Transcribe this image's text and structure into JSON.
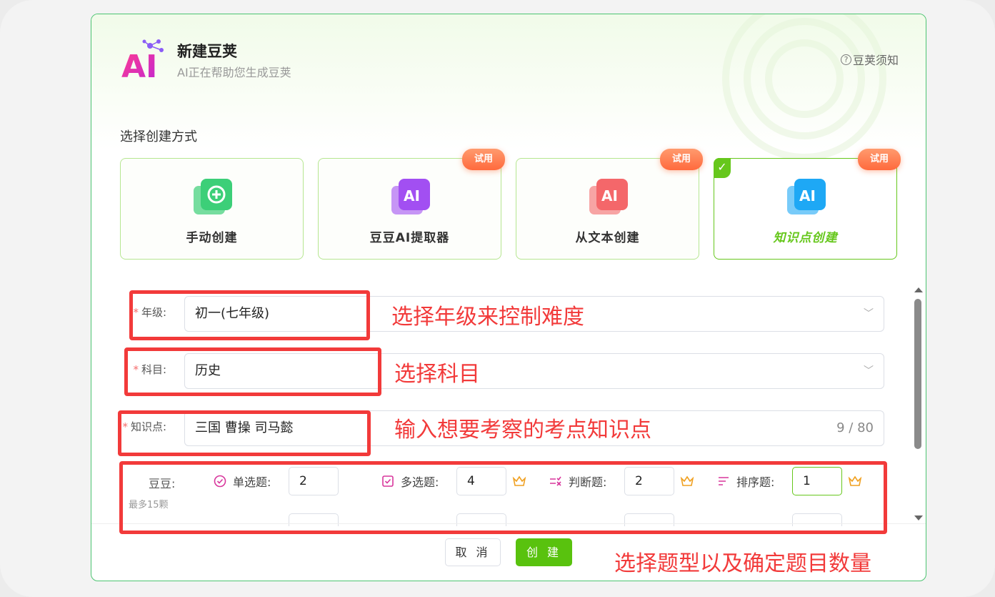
{
  "header": {
    "title": "新建豆荚",
    "subtitle": "AI正在帮助您生成豆荚",
    "notice_label": "豆荚须知",
    "logo_text": "AI"
  },
  "section_label": "选择创建方式",
  "cards": [
    {
      "label": "手动创建",
      "icon": "plus-circle-icon",
      "color": "#3ccf78",
      "trial": "",
      "selected": false
    },
    {
      "label": "豆豆AI提取器",
      "icon": "ai-icon",
      "color": "#a24ff2",
      "trial": "试用",
      "selected": false
    },
    {
      "label": "从文本创建",
      "icon": "ai-icon",
      "color": "#f4676a",
      "trial": "试用",
      "selected": false
    },
    {
      "label": "知识点创建",
      "icon": "ai-icon",
      "color": "#1ea8f5",
      "trial": "试用",
      "selected": true
    }
  ],
  "form": {
    "grade": {
      "label": "年级:",
      "value": "初一(七年级)"
    },
    "subject": {
      "label": "科目:",
      "value": "历史"
    },
    "knowledge": {
      "label": "知识点:",
      "value": "三国 曹操 司马懿",
      "count": "9 / 80"
    }
  },
  "question_types": {
    "label": "豆豆:",
    "sublabel": "最多15颗",
    "items": [
      {
        "name": "单选题:",
        "icon": "circle-check-icon",
        "value": "2",
        "premium": false
      },
      {
        "name": "多选题:",
        "icon": "square-check-icon",
        "value": "4",
        "premium": true
      },
      {
        "name": "判断题:",
        "icon": "check-cross-icon",
        "value": "2",
        "premium": true
      },
      {
        "name": "排序题:",
        "icon": "sort-icon",
        "value": "1",
        "premium": true
      }
    ]
  },
  "buttons": {
    "cancel": "取 消",
    "create": "创 建"
  },
  "annotations": {
    "grade": "选择年级来控制难度",
    "subject": "选择科目",
    "knowledge": "输入想要考察的考点知识点",
    "qtypes": "选择题型以及确定题目数量"
  },
  "colors": {
    "accent": "#66c71c",
    "annotation": "#f23a3a",
    "border": "#4cc471"
  }
}
